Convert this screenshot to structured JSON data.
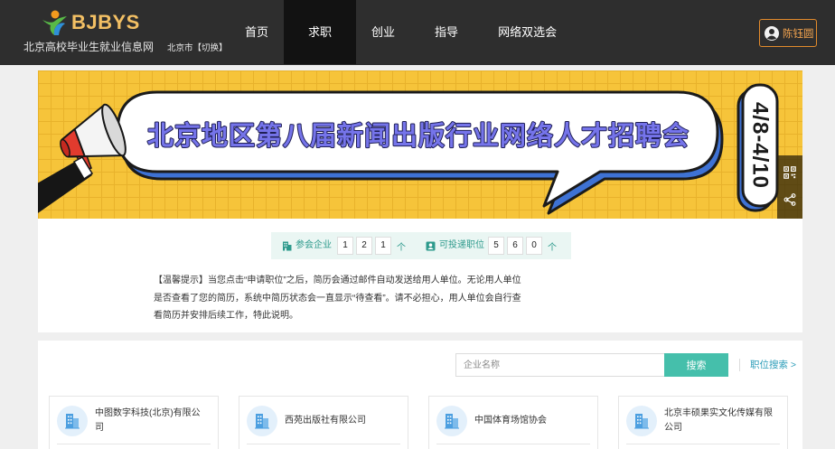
{
  "header": {
    "logo_text": "BJBYS",
    "site_name": "北京高校毕业生就业信息网",
    "city": "北京市",
    "city_switch": "【切换】",
    "nav": [
      {
        "label": "首页",
        "active": false
      },
      {
        "label": "求职",
        "active": true
      },
      {
        "label": "创业",
        "active": false
      },
      {
        "label": "指导",
        "active": false
      },
      {
        "label": "网络双选会",
        "active": false
      }
    ],
    "user": {
      "name": "陈钰圆",
      "icon": "avatar-icon"
    }
  },
  "banner": {
    "title": "北京地区第八届新闻出版行业网络人才招聘会",
    "date": "4/8-4/10",
    "side_icons": [
      "qr-code-icon",
      "share-icon"
    ]
  },
  "stats": {
    "companies": {
      "icon": "building-icon",
      "label": "参会企业",
      "digits": [
        "1",
        "2",
        "1"
      ],
      "unit": "个"
    },
    "positions": {
      "icon": "id-card-icon",
      "label": "可投递职位",
      "digits": [
        "5",
        "6",
        "0"
      ],
      "unit": "个"
    }
  },
  "notice": "【温馨提示】当您点击“申请职位”之后，简历会通过邮件自动发送给用人单位。无论用人单位是否查看了您的简历，系统中简历状态会一直显示“待查看”。请不必担心，用人单位会自行查看简历并安排后续工作，特此说明。",
  "search": {
    "placeholder": "企业名称",
    "button_label": "搜索",
    "position_search_link": "职位搜索 >"
  },
  "companies": [
    {
      "name": "中图数字科技(北京)有限公司",
      "icon": "building-icon"
    },
    {
      "name": "西苑出版社有限公司",
      "icon": "building-icon"
    },
    {
      "name": "中国体育场馆协会",
      "icon": "building-icon"
    },
    {
      "name": "北京丰硕果实文化传媒有限公司",
      "icon": "building-icon"
    }
  ],
  "colors": {
    "header_bg": "#2e2e2e",
    "nav_active_bg": "#121212",
    "accent": "#45bfab",
    "link": "#2a9cb8",
    "banner_yellow": "#f6c43a",
    "user_border": "#e38b2c",
    "stats_bg": "#eaf6f3"
  }
}
